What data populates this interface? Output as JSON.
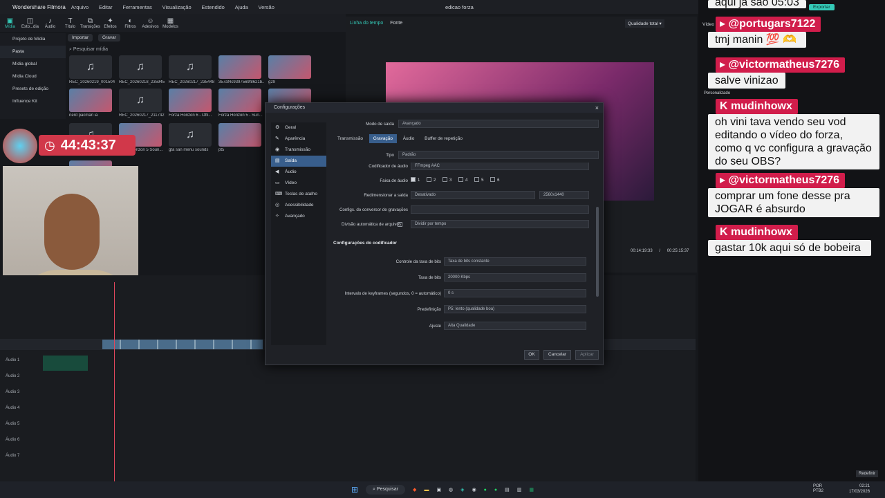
{
  "titlebar": {
    "app_name": "Wondershare Filmora",
    "menu": [
      "Arquivo",
      "Editar",
      "Ferramentas",
      "Visualização",
      "Estendido",
      "Ajuda",
      "Versão"
    ],
    "doc_title": "edicao forza"
  },
  "toolbar": {
    "tools": [
      "Mídia",
      "Esto...dia",
      "Áudio",
      "Título",
      "Transições",
      "Efeitos",
      "Filtros",
      "Adesivos",
      "Modelos"
    ]
  },
  "media_sidebar": {
    "items": [
      "Projeto de Mídia",
      "Pasta",
      "Mídia global",
      "Mídia Cloud",
      "Presets de edição",
      "Influence Kit"
    ]
  },
  "media_bar": {
    "import": "Importar",
    "record": "Gravar",
    "search_placeholder": "Pesquisar mídia"
  },
  "media_items": [
    {
      "name": "REC_20260219_001504",
      "type": "audio"
    },
    {
      "name": "REC_20260218_235945",
      "type": "audio"
    },
    {
      "name": "REC_20260217_235448",
      "type": "audio"
    },
    {
      "name": "357af4c9397569f8621b...",
      "type": "video"
    },
    {
      "name": "g29",
      "type": "video"
    },
    {
      "name": "nerd pacman ia",
      "type": "video",
      "duration": "00:00:58"
    },
    {
      "name": "REC_20260217_211742",
      "type": "audio"
    },
    {
      "name": "Forza Horizon 6 - Offi...",
      "type": "video",
      "duration": "00:01:09"
    },
    {
      "name": "Forza Horizon 5 - Sun...",
      "type": "video",
      "duration": "00:00:21"
    },
    {
      "name": "wallpaper",
      "type": "video",
      "duration": "00:02:11"
    },
    {
      "name": "REC_20260212_160137",
      "type": "audio"
    },
    {
      "name": "Forza Horizon 5 Soun...",
      "type": "video"
    },
    {
      "name": "gta san menu sounds",
      "type": "audio",
      "duration": "00:00:10"
    },
    {
      "name": "pt5",
      "type": "video",
      "duration": "00:00:13"
    },
    {
      "name": "pt1",
      "type": "video"
    },
    {
      "name": "troféu 3d animação",
      "type": "video"
    }
  ],
  "stream_timer": "44:43:37",
  "preview": {
    "tabs": [
      "Linha do tempo",
      "Fonte"
    ],
    "quality": "Qualidade total",
    "time_current": "00:14:19:33",
    "time_total": "00:25:15:37"
  },
  "timeline_tracks": [
    "Áudio 1",
    "Áudio 2",
    "Áudio 3",
    "Áudio 4",
    "Áudio 5",
    "Áudio 6",
    "Áudio 7"
  ],
  "chat": {
    "top_cut": "aqui ja sao 05:03",
    "export_btn": "Exportar",
    "video_label": "Vídeo",
    "messages": [
      {
        "user": "@portugars7122",
        "text": "tmj manin 💯 🫶"
      },
      {
        "user": "@victormatheus7276",
        "text": "salve vinizao"
      },
      {
        "user": "mudinhowx",
        "text": "oh vini tava vendo seu vod editando o vídeo do forza, como q vc configura a gravação do seu OBS?"
      },
      {
        "user": "@victormatheus7276",
        "text": "comprar um fone desse pra JOGAR é absurdo"
      },
      {
        "user": "mudinhowx",
        "text": "gastar 10k aqui só de bobeira"
      }
    ],
    "personalizado": "Personalizado",
    "redefinir": "Redefinir"
  },
  "dialog": {
    "title": "Configurações",
    "sidebar": [
      "Geral",
      "Aparência",
      "Transmissão",
      "Saída",
      "Áudio",
      "Vídeo",
      "Teclas de atalho",
      "Acessibilidade",
      "Avançado"
    ],
    "output_mode_label": "Modo de saída",
    "output_mode_value": "Avançado",
    "tabs": [
      "Transmissão",
      "Gravação",
      "Áudio",
      "Buffer de repetição"
    ],
    "type_label": "Tipo",
    "type_value": "Padrão",
    "audio_encoder_label": "Codificador de áudio",
    "audio_encoder_value": "FFmpeg AAC",
    "audio_track_label": "Faixa de áudio",
    "tracks": [
      "1",
      "2",
      "3",
      "4",
      "5",
      "6"
    ],
    "rescale_label": "Redimensionar a saída",
    "rescale_value": "Desativado",
    "rescale_res": "2560x1440",
    "muxer_label": "Configs. do conversor de gravações",
    "autosplit_label": "Divisão automática de arquivos",
    "autosplit_value": "Dividir por tempo",
    "encoder_section": "Configurações do codificador",
    "rate_control_label": "Controle da taxa de bits",
    "rate_control_value": "Taxa de bits constante",
    "bitrate_label": "Taxa de bits",
    "bitrate_value": "20000 Kbps",
    "keyframe_label": "Intervalo de keyframes (segundos, 0 = automático)",
    "keyframe_value": "0 s",
    "preset_label": "Predefinição",
    "preset_value": "P5: lento (qualidade boa)",
    "tune_label": "Ajuste",
    "tune_value": "Alta Qualidade",
    "ok": "OK",
    "cancel": "Cancelar",
    "apply": "Aplicar"
  },
  "taskbar": {
    "search": "Pesquisar",
    "lang": "POR\nPTB2",
    "time": "02:21",
    "date": "17/03/2026"
  }
}
